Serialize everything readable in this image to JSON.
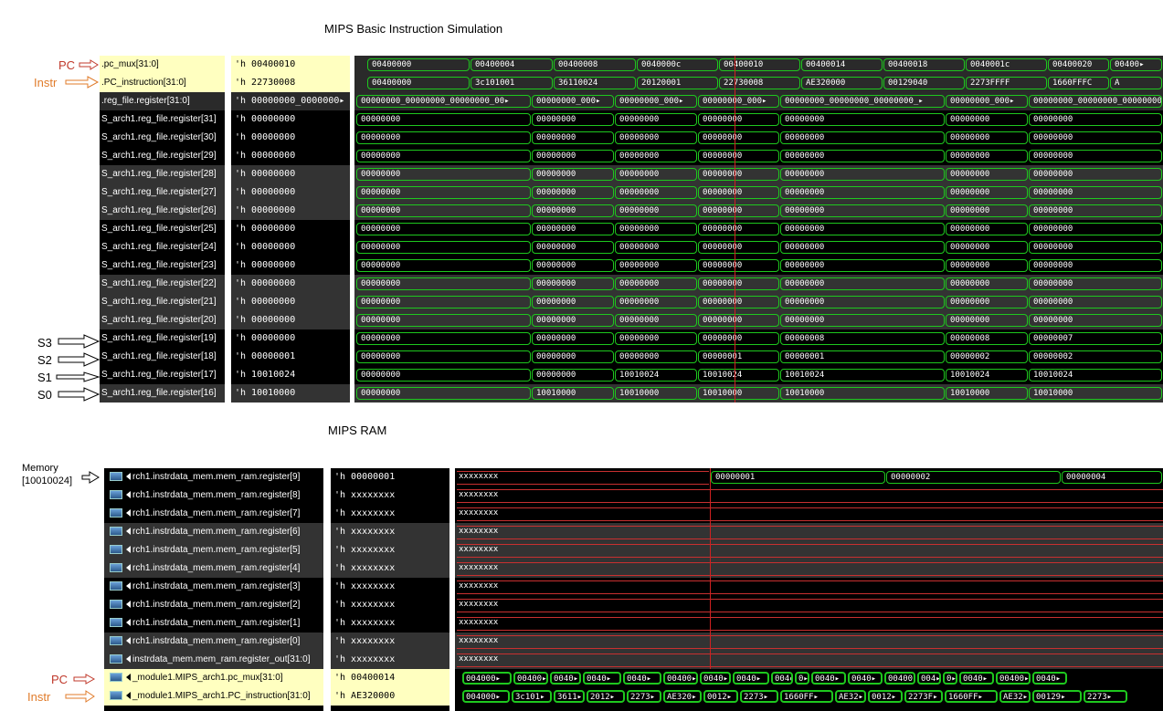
{
  "titles": {
    "sim": "MIPS Basic Instruction Simulation",
    "ram": "MIPS RAM"
  },
  "annotations": {
    "pc_top": "PC",
    "instr_top": "Instr",
    "s3": "S3",
    "s2": "S2",
    "s1": "S1",
    "s0": "S0",
    "memory_line1": "Memory",
    "memory_line2": "[10010024]",
    "pc_bottom": "PC",
    "instr_bottom": "Instr"
  },
  "colors": {
    "pc_annotation": "#c0392b",
    "instr_annotation": "#e07b2a",
    "highlight_row": "#ffffc0",
    "wave_green": "#1ec81e",
    "cursor_red": "#d02020"
  },
  "sim_panel": {
    "rows": [
      {
        "name": ".pc_mux[31:0]",
        "value": "'h 00400010",
        "hl": true
      },
      {
        "name": ".PC_instruction[31:0]",
        "value": "'h 22730008",
        "hl": true
      },
      {
        "name": ".reg_file.register[31:0]",
        "value": "'h 00000000_0000000▸",
        "hl": false
      },
      {
        "name": "S_arch1.reg_file.register[31]",
        "value": "'h 00000000",
        "hl": false
      },
      {
        "name": "S_arch1.reg_file.register[30]",
        "value": "'h 00000000",
        "hl": false
      },
      {
        "name": "S_arch1.reg_file.register[29]",
        "value": "'h 00000000",
        "hl": false
      },
      {
        "name": "S_arch1.reg_file.register[28]",
        "value": "'h 00000000",
        "hl": false
      },
      {
        "name": "S_arch1.reg_file.register[27]",
        "value": "'h 00000000",
        "hl": false
      },
      {
        "name": "S_arch1.reg_file.register[26]",
        "value": "'h 00000000",
        "hl": false
      },
      {
        "name": "S_arch1.reg_file.register[25]",
        "value": "'h 00000000",
        "hl": false
      },
      {
        "name": "S_arch1.reg_file.register[24]",
        "value": "'h 00000000",
        "hl": false
      },
      {
        "name": "S_arch1.reg_file.register[23]",
        "value": "'h 00000000",
        "hl": false
      },
      {
        "name": "S_arch1.reg_file.register[22]",
        "value": "'h 00000000",
        "hl": false
      },
      {
        "name": "S_arch1.reg_file.register[21]",
        "value": "'h 00000000",
        "hl": false
      },
      {
        "name": "S_arch1.reg_file.register[20]",
        "value": "'h 00000000",
        "hl": false
      },
      {
        "name": "S_arch1.reg_file.register[19]",
        "value": "'h 00000000",
        "hl": false
      },
      {
        "name": "S_arch1.reg_file.register[18]",
        "value": "'h 00000001",
        "hl": false
      },
      {
        "name": "S_arch1.reg_file.register[17]",
        "value": "'h 10010024",
        "hl": false
      },
      {
        "name": "S_arch1.reg_file.register[16]",
        "value": "'h 10010000",
        "hl": false
      }
    ],
    "waves": [
      [
        "00400000",
        "00400004",
        "00400008",
        "0040000c",
        "00400010",
        "00400014",
        "00400018",
        "0040001c",
        "00400020",
        "00400▸"
      ],
      [
        "00400000",
        "3c101001",
        "36110024",
        "20120001",
        "22730008",
        "AE320000",
        "00129040",
        "2273FFFF",
        "1660FFFC",
        "A"
      ],
      [
        "00000000_00000000_00000000_00▸",
        "00000000_000▸",
        "00000000_000▸",
        "00000000_000▸",
        "00000000_00000000_00000000_▸",
        "00000000_000▸",
        "00000000_00000000_00000000"
      ],
      [
        "00000000",
        "00000000",
        "00000000",
        "00000000",
        "00000000",
        "00000000",
        "00000000"
      ],
      [
        "00000000",
        "00000000",
        "00000000",
        "00000000",
        "00000000",
        "00000000",
        "00000000"
      ],
      [
        "00000000",
        "00000000",
        "00000000",
        "00000000",
        "00000000",
        "00000000",
        "00000000"
      ],
      [
        "00000000",
        "00000000",
        "00000000",
        "00000000",
        "00000000",
        "00000000",
        "00000000"
      ],
      [
        "00000000",
        "00000000",
        "00000000",
        "00000000",
        "00000000",
        "00000000",
        "00000000"
      ],
      [
        "00000000",
        "00000000",
        "00000000",
        "00000000",
        "00000000",
        "00000000",
        "00000000"
      ],
      [
        "00000000",
        "00000000",
        "00000000",
        "00000000",
        "00000000",
        "00000000",
        "00000000"
      ],
      [
        "00000000",
        "00000000",
        "00000000",
        "00000000",
        "00000000",
        "00000000",
        "00000000"
      ],
      [
        "00000000",
        "00000000",
        "00000000",
        "00000000",
        "00000000",
        "00000000",
        "00000000"
      ],
      [
        "00000000",
        "00000000",
        "00000000",
        "00000000",
        "00000000",
        "00000000",
        "00000000"
      ],
      [
        "00000000",
        "00000000",
        "00000000",
        "00000000",
        "00000000",
        "00000000",
        "00000000"
      ],
      [
        "00000000",
        "00000000",
        "00000000",
        "00000000",
        "00000000",
        "00000000",
        "00000000"
      ],
      [
        "00000000",
        "00000000",
        "00000000",
        "00000000",
        "00000008",
        "00000008",
        "00000007"
      ],
      [
        "00000000",
        "00000000",
        "00000000",
        "00000001",
        "00000001",
        "00000002",
        "00000002"
      ],
      [
        "00000000",
        "00000000",
        "10010024",
        "10010024",
        "10010024",
        "10010024",
        "10010024"
      ],
      [
        "00000000",
        "10010000",
        "10010000",
        "10010000",
        "10010000",
        "10010000",
        "10010000"
      ]
    ]
  },
  "ram_panel": {
    "rows": [
      {
        "name": "rch1.instrdata_mem.mem_ram.register[9]",
        "value": "'h 00000001",
        "hl": false
      },
      {
        "name": "rch1.instrdata_mem.mem_ram.register[8]",
        "value": "'h xxxxxxxx",
        "hl": false
      },
      {
        "name": "rch1.instrdata_mem.mem_ram.register[7]",
        "value": "'h xxxxxxxx",
        "hl": false
      },
      {
        "name": "rch1.instrdata_mem.mem_ram.register[6]",
        "value": "'h xxxxxxxx",
        "hl": false
      },
      {
        "name": "rch1.instrdata_mem.mem_ram.register[5]",
        "value": "'h xxxxxxxx",
        "hl": false
      },
      {
        "name": "rch1.instrdata_mem.mem_ram.register[4]",
        "value": "'h xxxxxxxx",
        "hl": false
      },
      {
        "name": "rch1.instrdata_mem.mem_ram.register[3]",
        "value": "'h xxxxxxxx",
        "hl": false
      },
      {
        "name": "rch1.instrdata_mem.mem_ram.register[2]",
        "value": "'h xxxxxxxx",
        "hl": false
      },
      {
        "name": "rch1.instrdata_mem.mem_ram.register[1]",
        "value": "'h xxxxxxxx",
        "hl": false
      },
      {
        "name": "rch1.instrdata_mem.mem_ram.register[0]",
        "value": "'h xxxxxxxx",
        "hl": false
      },
      {
        "name": "instrdata_mem.mem_ram.register_out[31:0]",
        "value": "'h xxxxxxxx",
        "hl": false
      },
      {
        "name": "_module1.MIPS_arch1.pc_mux[31:0]",
        "value": "'h 00400014",
        "hl": true
      },
      {
        "name": "_module1.MIPS_arch1.PC_instruction[31:0]",
        "value": "'h AE320000",
        "hl": true
      }
    ],
    "xlabel": "xxxxxxxx",
    "mem9_waves": [
      "00000001",
      "00000002",
      "00000004"
    ],
    "pc_waves": [
      "004000▸",
      "00400▸",
      "0040▸",
      "0040▸",
      "0040▸",
      "00400▸",
      "0040▸",
      "0040▸",
      "004▸",
      "0▸",
      "0040▸",
      "0040▸",
      "00400▸",
      "004▸",
      "0▸",
      "0040▸",
      "00400▸",
      "0040▸"
    ],
    "instr_waves": [
      "004000▸",
      "3c101▸",
      "3611▸",
      "2012▸",
      "2273▸",
      "AE320▸",
      "0012▸",
      "2273▸",
      "1660FF▸",
      "AE32▸",
      "0012▸",
      "2273F▸",
      "1660FF▸",
      "AE32▸",
      "00129▸",
      "2273▸"
    ]
  }
}
